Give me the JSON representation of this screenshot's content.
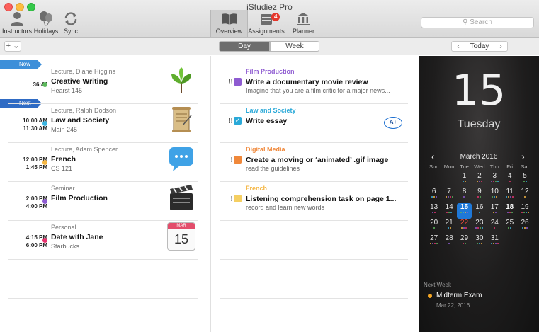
{
  "window": {
    "title": "iStudiez Pro"
  },
  "toolbar": {
    "instructors": "Instructors",
    "holidays": "Holidays",
    "sync": "Sync",
    "overview": "Overview",
    "assignments": "Assignments",
    "assignments_badge": "4",
    "planner": "Planner",
    "search_placeholder": "Search"
  },
  "subbar": {
    "add": "+ ⌄",
    "day": "Day",
    "week": "Week",
    "prev": "‹",
    "today": "Today",
    "next": "›"
  },
  "tags": {
    "now": "Now",
    "next": "Next"
  },
  "events": [
    {
      "kind": "Lecture, Diane Higgins",
      "title": "Creative Writing",
      "room": "Hearst 145",
      "time_start": "36:44",
      "time_end": "",
      "dot": "#5cb85c"
    },
    {
      "kind": "Lecture, Ralph Dodson",
      "title": "Law and Society",
      "room": "Main 245",
      "time_start": "10:00 AM",
      "time_end": "11:30 AM",
      "dot": "#3ab4e0"
    },
    {
      "kind": "Lecture, Adam Spencer",
      "title": "French",
      "room": "CS 121",
      "time_start": "12:00 PM",
      "time_end": "1:45 PM",
      "dot": "#f5b642"
    },
    {
      "kind": "Seminar",
      "title": "Film Production",
      "room": "",
      "time_start": "2:00 PM",
      "time_end": "4:00 PM",
      "dot": "#8e5bd1"
    },
    {
      "kind": "Personal",
      "title": "Date with Jane",
      "room": "Starbucks",
      "time_start": "4:15 PM",
      "time_end": "6:00 PM",
      "dot": "#e8336e"
    }
  ],
  "calendar_icon": {
    "month": "MAR",
    "day": "15"
  },
  "tasks": [
    {
      "course": "Film Production",
      "course_color": "#8e5bd1",
      "priority": "!!",
      "check_color": "#8e5bd1",
      "title": "Write a documentary movie review",
      "note": "Imagine that you are a film critic for a major news..."
    },
    {
      "course": "Law and Society",
      "course_color": "#2aa9d8",
      "priority": "!!",
      "check_color": "#2aa9d8",
      "title": "Write essay",
      "note": "",
      "grade": "A+"
    },
    {
      "course": "Digital Media",
      "course_color": "#f0883a",
      "priority": "!",
      "check_color": "#f0883a",
      "title": "Create a moving or ‘animated’ .gif image",
      "note": "read the guidelines"
    },
    {
      "course": "French",
      "course_color": "#f5b642",
      "priority": "!",
      "check_color": "#f5cf62",
      "title": "Listening comprehension task on page 1...",
      "note": "record and learn new words"
    }
  ],
  "panel": {
    "day_number": "15",
    "weekday": "Tuesday",
    "month_title": "March 2016",
    "prev": "‹",
    "next": "›",
    "dow": [
      "Sun",
      "Mon",
      "Tue",
      "Wed",
      "Thu",
      "Fri",
      "Sat"
    ],
    "weeks": [
      [
        "",
        "",
        "1",
        "2",
        "3",
        "4",
        "5"
      ],
      [
        "6",
        "7",
        "8",
        "9",
        "10",
        "11",
        "12"
      ],
      [
        "13",
        "14",
        "15",
        "16",
        "17",
        "18",
        "19"
      ],
      [
        "20",
        "21",
        "22",
        "23",
        "24",
        "25",
        "26"
      ],
      [
        "27",
        "28",
        "29",
        "30",
        "31",
        "",
        ""
      ]
    ],
    "next_week_label": "Next Week",
    "next_week_item": "Midterm Exam",
    "next_week_date": "Mar 22, 2016"
  }
}
